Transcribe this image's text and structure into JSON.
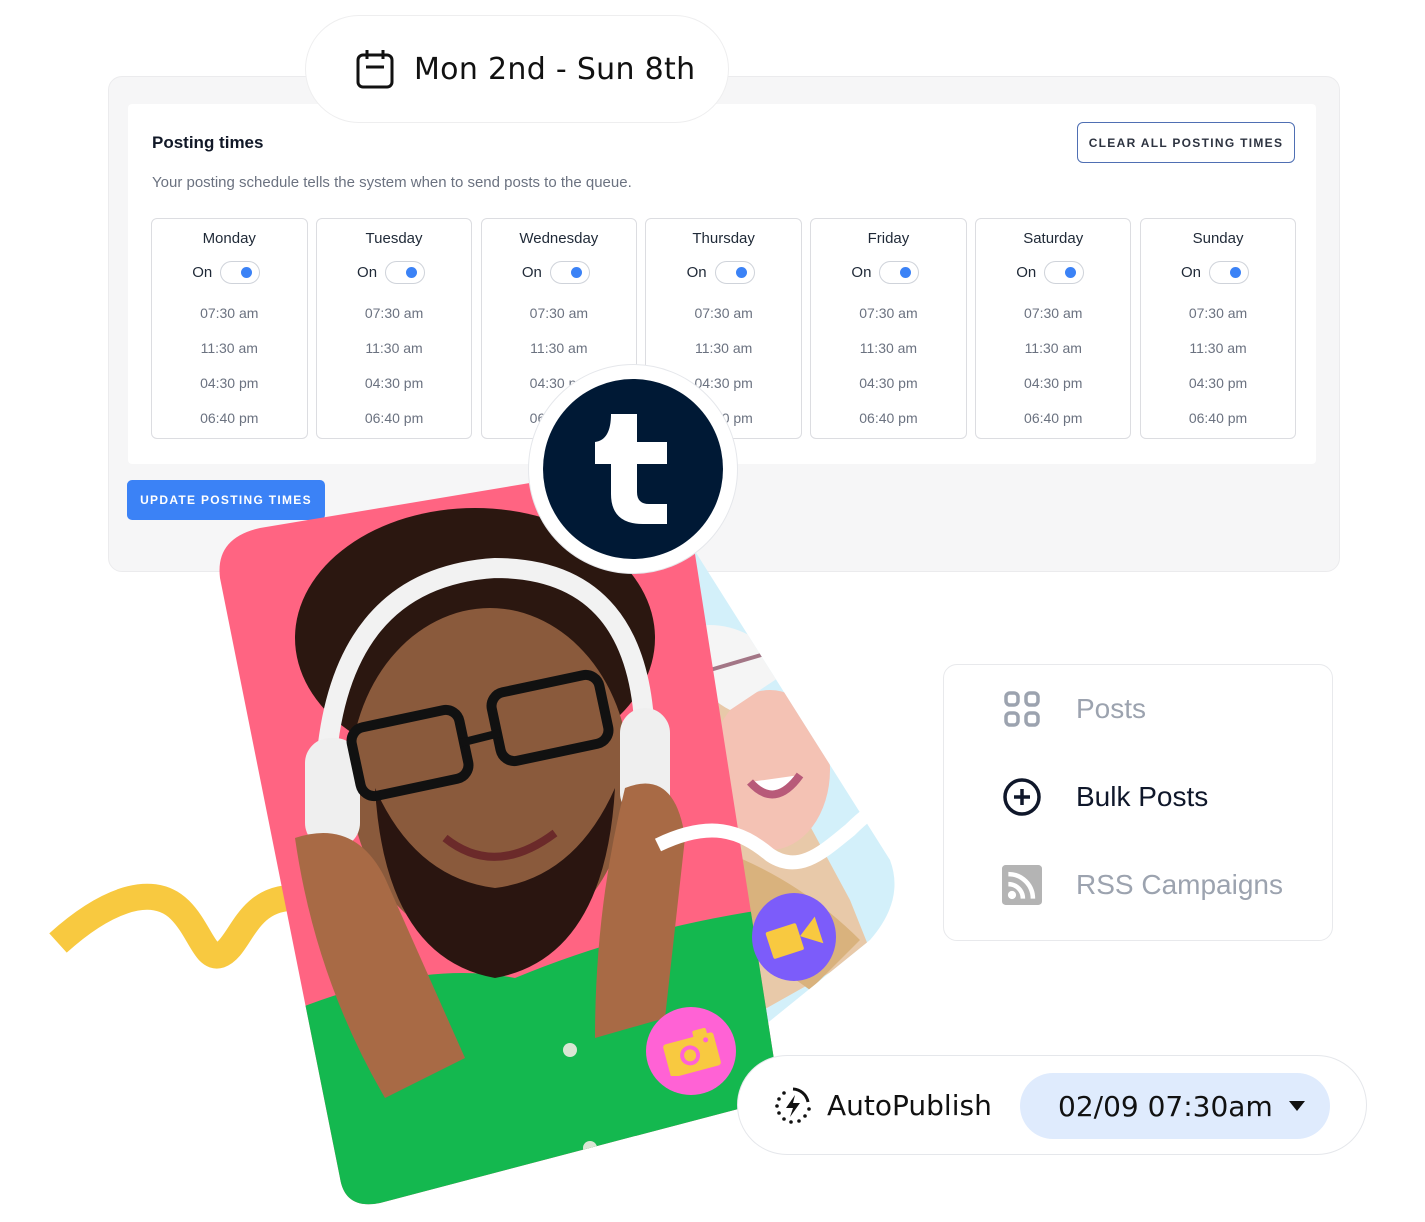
{
  "date_range": {
    "icon": "calendar-icon",
    "label": "Mon 2nd - Sun 8th"
  },
  "schedule": {
    "title": "Posting times",
    "description": "Your posting schedule tells the system when to send posts to the queue.",
    "clear_button": "CLEAR ALL POSTING TIMES",
    "update_button": "UPDATE POSTING TIMES",
    "colors": {
      "accent": "#3b82f6",
      "clear_border": "#4f6fb3"
    },
    "days": [
      {
        "name": "Monday",
        "toggle_label": "On",
        "enabled": true,
        "times": [
          "07:30 am",
          "11:30 am",
          "04:30 pm",
          "06:40 pm"
        ]
      },
      {
        "name": "Tuesday",
        "toggle_label": "On",
        "enabled": true,
        "times": [
          "07:30 am",
          "11:30 am",
          "04:30 pm",
          "06:40 pm"
        ]
      },
      {
        "name": "Wednesday",
        "toggle_label": "On",
        "enabled": true,
        "times": [
          "07:30 am",
          "11:30 am",
          "04:30 pm",
          "06:40 pm"
        ]
      },
      {
        "name": "Thursday",
        "toggle_label": "On",
        "enabled": true,
        "times": [
          "07:30 am",
          "11:30 am",
          "04:30 pm",
          "06:40 pm"
        ]
      },
      {
        "name": "Friday",
        "toggle_label": "On",
        "enabled": true,
        "times": [
          "07:30 am",
          "11:30 am",
          "04:30 pm",
          "06:40 pm"
        ]
      },
      {
        "name": "Saturday",
        "toggle_label": "On",
        "enabled": true,
        "times": [
          "07:30 am",
          "11:30 am",
          "04:30 pm",
          "06:40 pm"
        ]
      },
      {
        "name": "Sunday",
        "toggle_label": "On",
        "enabled": true,
        "times": [
          "07:30 am",
          "11:30 am",
          "04:30 pm",
          "06:40 pm"
        ]
      }
    ]
  },
  "badges": {
    "tumblr": {
      "icon": "tumblr-logo-icon",
      "glyph": "t",
      "color": "#001935"
    },
    "video": {
      "icon": "video-camera-icon",
      "color": "#7c5cfa"
    },
    "camera": {
      "icon": "camera-icon",
      "color": "#ff62d5"
    }
  },
  "photos": {
    "main": {
      "description": "Man with headphones and glasses smiling, pink background, green shirt",
      "bg_color": "#ff6482"
    },
    "back": {
      "description": "Smiling woman in white hat",
      "bg_color": "#d3f0fa"
    }
  },
  "menu": {
    "items": [
      {
        "label": "Posts",
        "icon": "grid-icon",
        "state": "muted"
      },
      {
        "label": "Bulk Posts",
        "icon": "plus-circle-icon",
        "state": "active"
      },
      {
        "label": "RSS Campaigns",
        "icon": "rss-icon",
        "state": "muted"
      }
    ]
  },
  "autopublish": {
    "icon": "lightning-timer-icon",
    "label": "AutoPublish",
    "selected_value": "02/09 07:30am"
  }
}
